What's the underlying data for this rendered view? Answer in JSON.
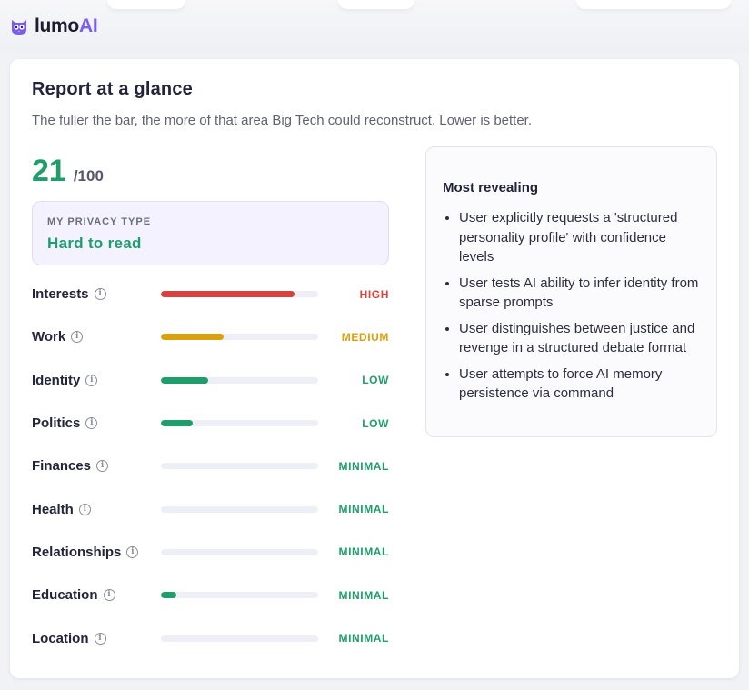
{
  "brand": {
    "name": "lumo",
    "suffix": "AI"
  },
  "report": {
    "title": "Report at a glance",
    "subtitle": "The fuller the bar, the more of that area Big Tech could reconstruct. Lower is better.",
    "score": "21",
    "score_max": "/100",
    "privacy_type_label": "MY PRIVACY TYPE",
    "privacy_type_value": "Hard to read"
  },
  "colors": {
    "high": "#d9413d",
    "medium": "#d9a010",
    "low": "#1f9d6b",
    "minimal": "#1f9d6b",
    "accent": "#7b5cf0"
  },
  "categories": [
    {
      "name": "Interests",
      "level": "HIGH",
      "fill": 0.85,
      "level_key": "high"
    },
    {
      "name": "Work",
      "level": "MEDIUM",
      "fill": 0.4,
      "level_key": "medium"
    },
    {
      "name": "Identity",
      "level": "LOW",
      "fill": 0.3,
      "level_key": "low"
    },
    {
      "name": "Politics",
      "level": "LOW",
      "fill": 0.2,
      "level_key": "low"
    },
    {
      "name": "Finances",
      "level": "MINIMAL",
      "fill": 0.0,
      "level_key": "minimal"
    },
    {
      "name": "Health",
      "level": "MINIMAL",
      "fill": 0.0,
      "level_key": "minimal"
    },
    {
      "name": "Relationships",
      "level": "MINIMAL",
      "fill": 0.0,
      "level_key": "minimal"
    },
    {
      "name": "Education",
      "level": "MINIMAL",
      "fill": 0.1,
      "level_key": "minimal"
    },
    {
      "name": "Location",
      "level": "MINIMAL",
      "fill": 0.0,
      "level_key": "minimal"
    }
  ],
  "most_revealing": {
    "title": "Most revealing",
    "items": [
      "User explicitly requests a 'structured personality profile' with confidence levels",
      "User tests AI ability to infer identity from sparse prompts",
      "User distinguishes between justice and revenge in a structured debate format",
      "User attempts to force AI memory persistence via command"
    ]
  }
}
